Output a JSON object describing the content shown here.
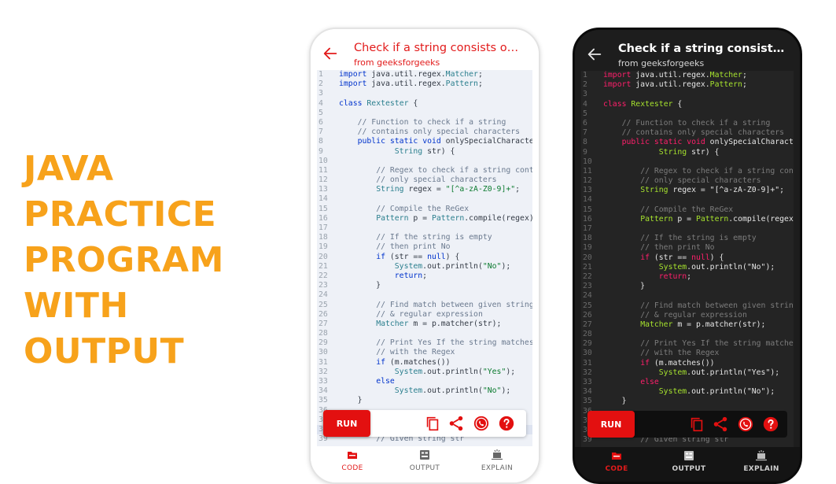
{
  "promo": {
    "lines": [
      "JAVA",
      "PRACTICE",
      "PROGRAM",
      "WITH",
      "OUTPUT"
    ]
  },
  "header": {
    "title": "Check if a string consists only of special characters",
    "subtitle": "from geeksforgeeks"
  },
  "code_lines": [
    "import java.util.regex.Matcher;",
    "import java.util.regex.Pattern;",
    "",
    "class Rextester {",
    "",
    "    // Function to check if a string",
    "    // contains only special characters",
    "    public static void onlySpecialCharacters(",
    "            String str) {",
    "",
    "        // Regex to check if a string contains",
    "        // only special characters",
    "        String regex = \"[^a-zA-Z0-9]+\";",
    "",
    "        // Compile the ReGex",
    "        Pattern p = Pattern.compile(regex);",
    "",
    "        // If the string is empty",
    "        // then print No",
    "        if (str == null) {",
    "            System.out.println(\"No\");",
    "            return;",
    "        }",
    "",
    "        // Find match between given string",
    "        // & regular expression",
    "        Matcher m = p.matcher(str);",
    "",
    "        // Print Yes If the string matches",
    "        // with the Regex",
    "        if (m.matches())",
    "            System.out.println(\"Yes\");",
    "        else",
    "            System.out.println(\"No\");",
    "    }",
    "",
    "",
    "",
    "        // Given string str"
  ],
  "actions": {
    "run_label": "RUN"
  },
  "nav": [
    {
      "label": "CODE",
      "icon": "code-tab-icon",
      "active": true
    },
    {
      "label": "OUTPUT",
      "icon": "output-tab-icon",
      "active": false
    },
    {
      "label": "EXPLAIN",
      "icon": "explain-tab-icon",
      "active": false
    }
  ],
  "colors": {
    "accent": "#e31010",
    "promo_orange": "#f7a21b",
    "light_code_bg": "#eef1f7",
    "dark_code_bg": "#242424"
  }
}
